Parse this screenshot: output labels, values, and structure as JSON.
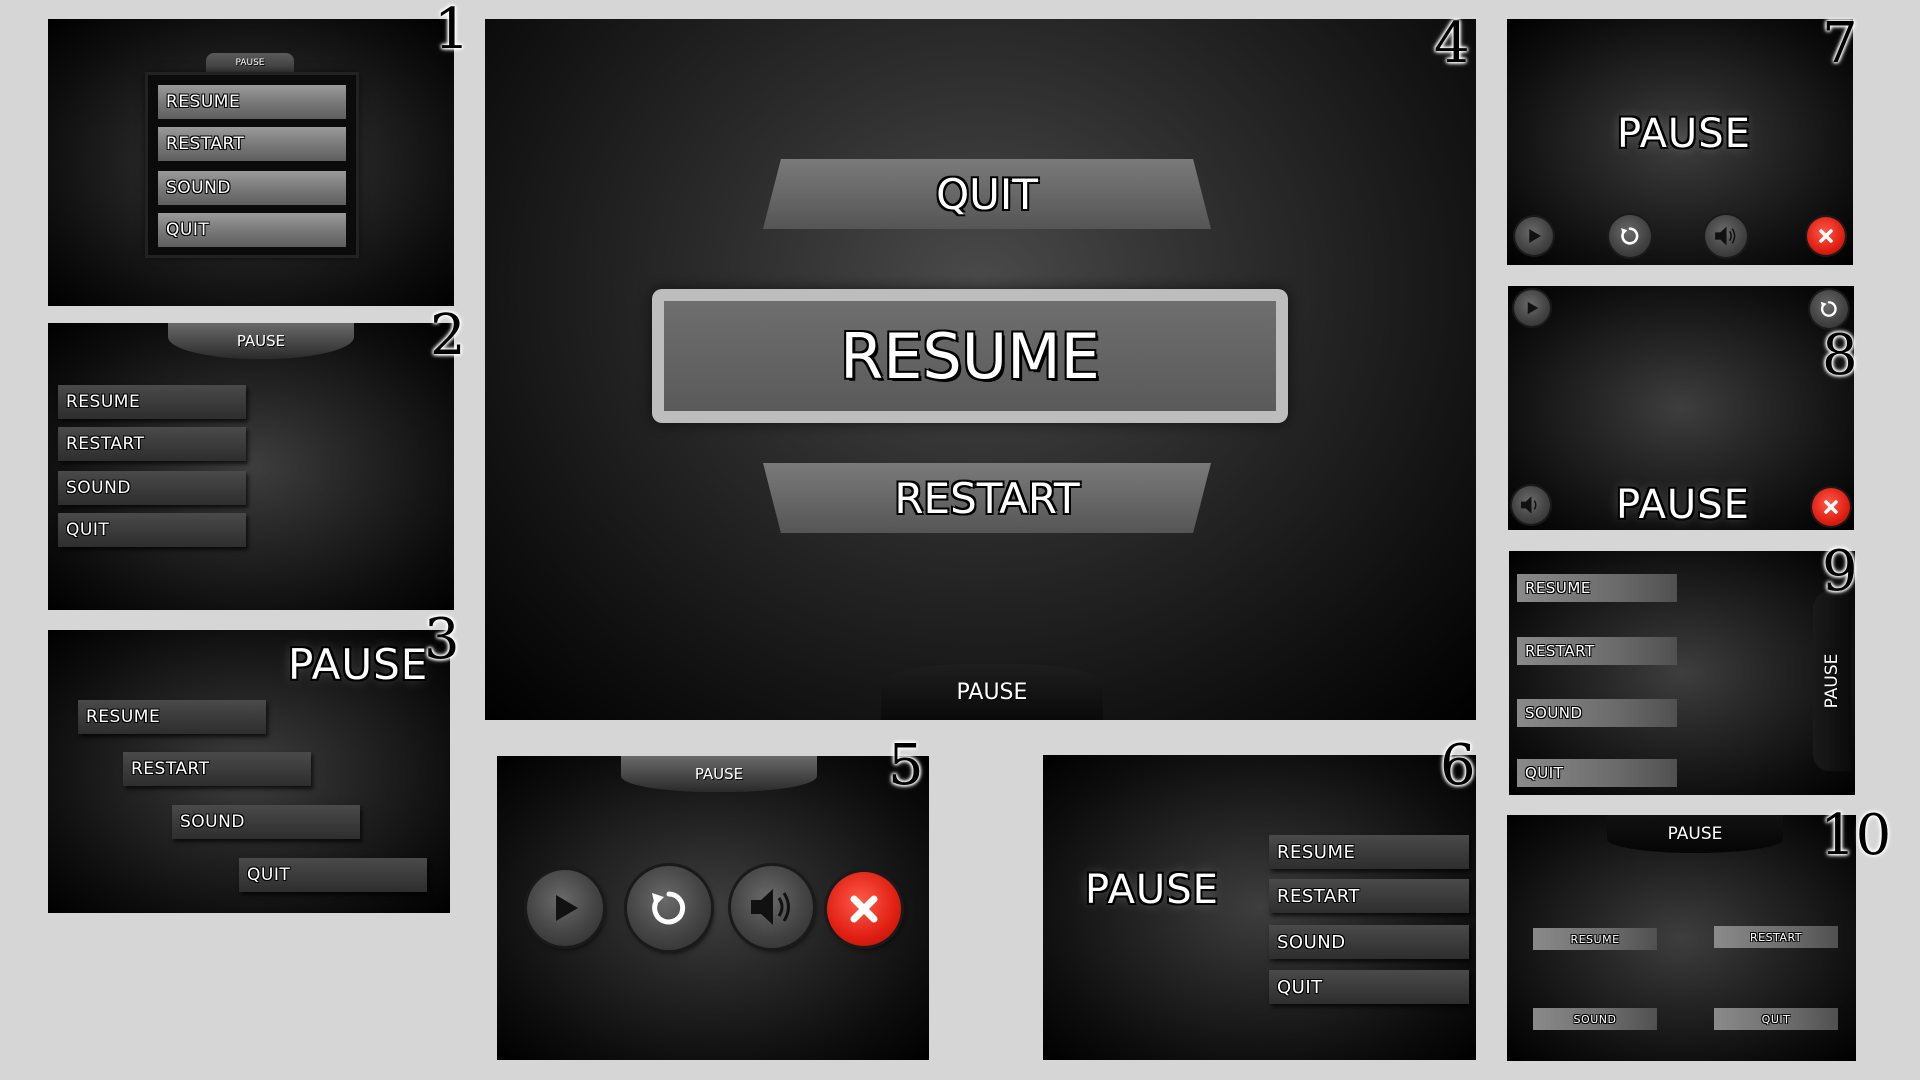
{
  "panels": {
    "p1": {
      "number": "1",
      "tab": "PAUSE",
      "buttons": [
        "RESUME",
        "RESTART",
        "SOUND",
        "QUIT"
      ]
    },
    "p2": {
      "number": "2",
      "tab": "PAUSE",
      "buttons": [
        "RESUME",
        "RESTART",
        "SOUND",
        "QUIT"
      ]
    },
    "p3": {
      "number": "3",
      "title": "PAUSE",
      "buttons": [
        "RESUME",
        "RESTART",
        "SOUND",
        "QUIT"
      ]
    },
    "p4": {
      "number": "4",
      "quit": "QUIT",
      "resume": "RESUME",
      "restart": "RESTART",
      "tab": "PAUSE"
    },
    "p5": {
      "number": "5",
      "tab": "PAUSE",
      "icons": [
        "play-icon",
        "restart-icon",
        "sound-icon",
        "close-icon"
      ]
    },
    "p6": {
      "number": "6",
      "title": "PAUSE",
      "buttons": [
        "RESUME",
        "RESTART",
        "SOUND",
        "QUIT"
      ]
    },
    "p7": {
      "number": "7",
      "title": "PAUSE",
      "icons": [
        "play-icon",
        "restart-icon",
        "sound-icon",
        "close-icon"
      ]
    },
    "p8": {
      "number": "8",
      "title": "PAUSE",
      "icons": [
        "play-icon",
        "restart-icon",
        "sound-icon",
        "close-icon"
      ]
    },
    "p9": {
      "number": "9",
      "side_label": "PAUSE",
      "buttons": [
        "RESUME",
        "RESTART",
        "SOUND",
        "QUIT"
      ]
    },
    "p10": {
      "number": "10",
      "tab": "PAUSE",
      "buttons": [
        "RESUME",
        "RESTART",
        "SOUND",
        "QUIT"
      ]
    }
  },
  "colors": {
    "background": "#d6d6d6",
    "panel": "#1a1a1a",
    "button": "#7a7a7a",
    "close_red": "#e01f12",
    "text": "#ffffff"
  }
}
